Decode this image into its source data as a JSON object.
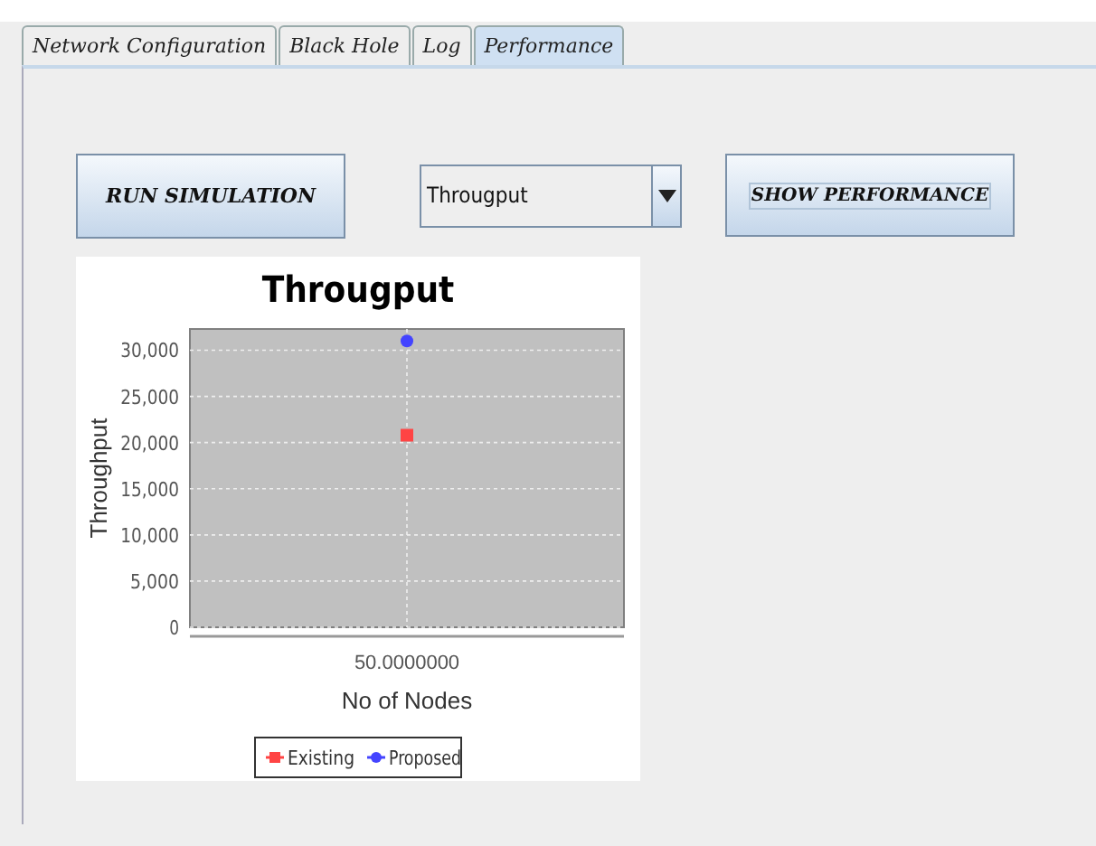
{
  "tabs": [
    {
      "label": "Network Configuration",
      "selected": false
    },
    {
      "label": "Black Hole",
      "selected": false
    },
    {
      "label": "Log",
      "selected": false
    },
    {
      "label": "Performance",
      "selected": true
    }
  ],
  "run_button": "RUN SIMULATION",
  "metric_select": {
    "value": "Througput"
  },
  "show_button": "SHOW PERFORMANCE",
  "chart_data": {
    "type": "scatter",
    "title": "Througput",
    "xlabel": "No of Nodes",
    "ylabel": "Throughput",
    "categories": [
      "50.0000000"
    ],
    "grid": true,
    "legend": "bottom",
    "ylim": [
      0,
      32300
    ],
    "yticks": [
      {
        "value": 0,
        "label": "0"
      },
      {
        "value": 5000,
        "label": "5,000"
      },
      {
        "value": 10000,
        "label": "10,000"
      },
      {
        "value": 15000,
        "label": "15,000"
      },
      {
        "value": 20000,
        "label": "20,000"
      },
      {
        "value": 25000,
        "label": "25,000"
      },
      {
        "value": 30000,
        "label": "30,000"
      }
    ],
    "series": [
      {
        "name": "Existing",
        "color": "#ff4444",
        "values": [
          20800
        ]
      },
      {
        "name": "Proposed",
        "color": "#4444ff",
        "values": [
          31000
        ]
      }
    ]
  }
}
